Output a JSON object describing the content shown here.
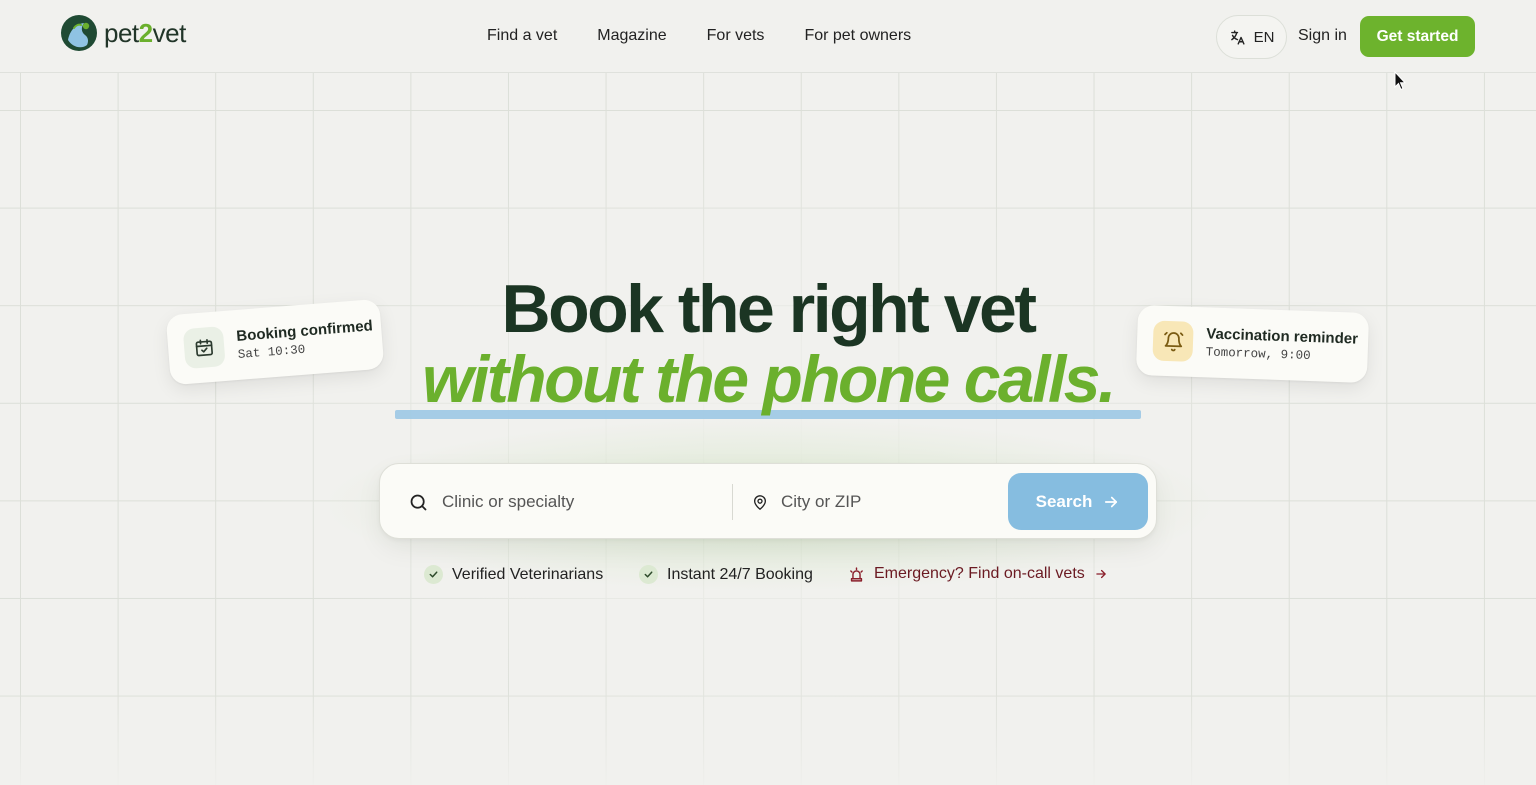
{
  "header": {
    "logo_text_a": "pet",
    "logo_text_b": "2",
    "logo_text_c": "vet",
    "nav": [
      {
        "label": "Find a vet"
      },
      {
        "label": "Magazine"
      },
      {
        "label": "For vets"
      },
      {
        "label": "For pet owners"
      }
    ],
    "language": "EN",
    "sign_in": "Sign in",
    "cta": "Get started"
  },
  "hero": {
    "headline_line1": "Book the right vet",
    "headline_line2": "without the phone calls."
  },
  "cards": {
    "booking": {
      "title": "Booking confirmed",
      "subtitle": "Sat 10:30",
      "icon": "calendar-check-icon"
    },
    "reminder": {
      "title": "Vaccination reminder",
      "subtitle": "Tomorrow, 9:00",
      "icon": "bell-icon"
    }
  },
  "search": {
    "clinic_placeholder": "Clinic or specialty",
    "city_placeholder": "City or ZIP",
    "button_label": "Search"
  },
  "features": [
    {
      "label": "Verified Veterinarians"
    },
    {
      "label": "Instant 24/7 Booking"
    },
    {
      "label": "Emergency? Find on-call vets"
    }
  ],
  "colors": {
    "brand_green": "#6db32d",
    "headline_dark": "#1b3523",
    "search_button": "#86bde0",
    "emergency_text": "#6b1a22"
  }
}
